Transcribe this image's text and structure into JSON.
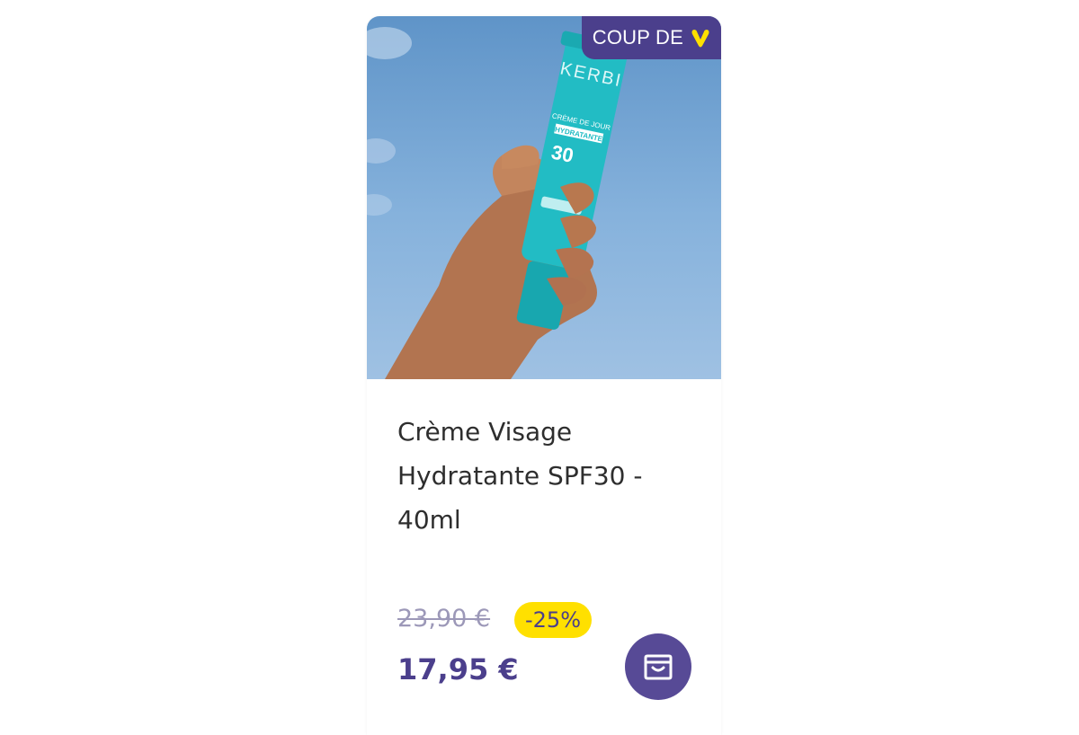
{
  "product": {
    "badge_label": "COUP DE",
    "badge_icon": "heart-icon",
    "title": "Crème Visage Hydratante SPF30 - 40ml",
    "old_price": "23,90 €",
    "discount": "-25%",
    "price": "17,95 €",
    "cart_icon": "shopping-bag-icon",
    "tube": {
      "brand": "KERBI",
      "line1": "CRÈME DE JOUR",
      "line2": "HYDRATANTE",
      "spf": "30"
    }
  },
  "colors": {
    "brand_purple": "#4b3f8c",
    "accent_yellow": "#ffe000",
    "tube_teal": "#22bcc4",
    "sky_blue": "#7eaad8"
  }
}
